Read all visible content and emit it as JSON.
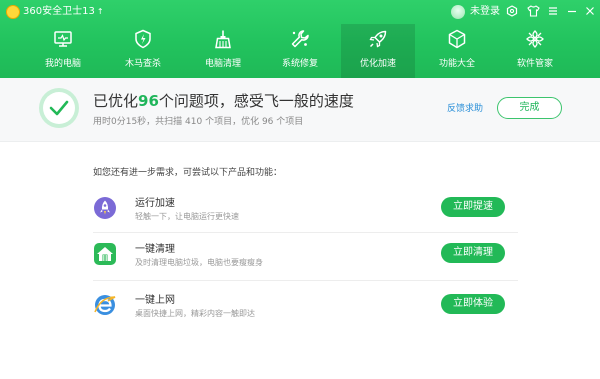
{
  "titlebar": {
    "app_name": "360安全卫士13",
    "update_arrow": "↑",
    "login_label": "未登录",
    "icons": [
      "shield-settings-icon",
      "shirt-skin-icon",
      "menu-icon",
      "minimize-icon",
      "close-icon"
    ]
  },
  "nav": {
    "items": [
      {
        "label": "我的电脑",
        "icon": "monitor-icon"
      },
      {
        "label": "木马查杀",
        "icon": "shield-bolt-icon"
      },
      {
        "label": "电脑清理",
        "icon": "broom-icon"
      },
      {
        "label": "系统修复",
        "icon": "wrench-icon"
      },
      {
        "label": "优化加速",
        "icon": "rocket-icon",
        "active": true
      },
      {
        "label": "功能大全",
        "icon": "cube-icon"
      },
      {
        "label": "软件管家",
        "icon": "flower-icon"
      }
    ]
  },
  "result": {
    "title_prefix": "已优化",
    "count": "96",
    "title_suffix": "个问题项，感受飞一般的速度",
    "summary": "用时0分15秒，共扫描 410 个项目，优化 96 个项目",
    "feedback_label": "反馈求助",
    "done_label": "完成"
  },
  "suggestions": {
    "intro": "如您还有进一步需求，可尝试以下产品和功能：",
    "items": [
      {
        "name": "运行加速",
        "desc": "轻触一下，让电脑运行更快速",
        "button": "立即提速",
        "icon": "rocket-badge-icon"
      },
      {
        "name": "一键清理",
        "desc": "及时清理电脑垃圾，电脑也要瘦瘦身",
        "button": "立即清理",
        "icon": "house-broom-icon"
      },
      {
        "name": "一键上网",
        "desc": "桌面快捷上网，精彩内容一触即达",
        "button": "立即体验",
        "icon": "browser-e-icon"
      }
    ]
  },
  "colors": {
    "brand_green": "#22c35e",
    "accent_green": "#1fb55a",
    "link_blue": "#2a8fd8"
  }
}
